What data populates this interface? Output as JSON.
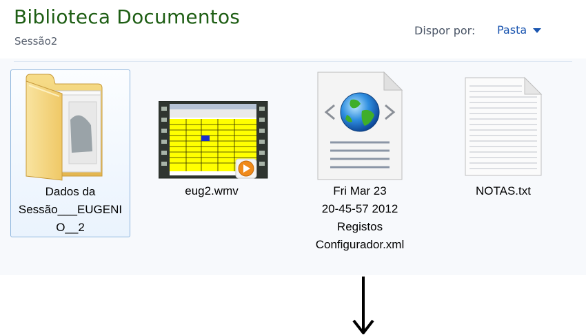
{
  "header": {
    "title": "Biblioteca Documentos",
    "subtitle": "Sessão2",
    "arrange_label": "Dispor por:",
    "arrange_value": "Pasta"
  },
  "items": [
    {
      "label_lines": [
        "Dados da",
        "Sessão___EUGENI",
        "O__2"
      ],
      "kind": "folder",
      "selected": true
    },
    {
      "label_lines": [
        "eug2.wmv"
      ],
      "kind": "video"
    },
    {
      "label_lines": [
        "Fri Mar 23",
        "20-45-57 2012",
        "Registos",
        "Configurador.xml"
      ],
      "kind": "xml"
    },
    {
      "label_lines": [
        "NOTAS.txt"
      ],
      "kind": "text"
    }
  ],
  "colors": {
    "title": "#1e5e14",
    "link": "#1a55b0",
    "selection_border": "#8cb4dd"
  }
}
